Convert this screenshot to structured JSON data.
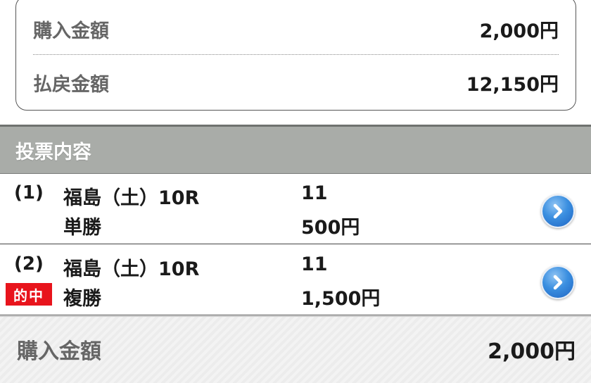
{
  "summary": {
    "purchase_label": "購入金額",
    "purchase_value": "2,000円",
    "payout_label": "払戻金額",
    "payout_value": "12,150円"
  },
  "section": {
    "title": "投票内容"
  },
  "bets": [
    {
      "number": "(1)",
      "venue": "福島（土）10R",
      "combination": "11",
      "bet_type": "単勝",
      "amount": "500円",
      "badge": "",
      "detail_icon": "chevron-right-icon"
    },
    {
      "number": "(2)",
      "venue": "福島（土）10R",
      "combination": "11",
      "bet_type": "複勝",
      "amount": "1,500円",
      "badge": "的中",
      "detail_icon": "chevron-right-icon"
    }
  ],
  "footer": {
    "total_label": "購入金額",
    "total_value": "2,000円"
  },
  "colors": {
    "header_bg": "#a9aca8",
    "hit_badge": "#e8141c",
    "arrow_button": "#2f7fd8"
  }
}
